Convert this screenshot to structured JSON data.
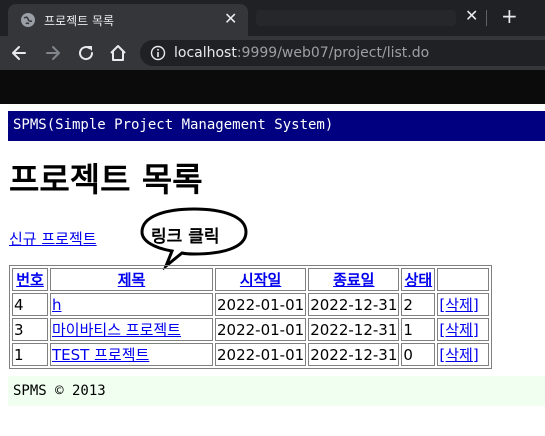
{
  "browser": {
    "tab_title": "프로젝트 목록",
    "tab_close_glyph": "✕",
    "tabbar_close_glyph": "✕",
    "new_tab_glyph": "+",
    "url_host": "localhost",
    "url_rest": ":9999/web07/project/list.do",
    "icons": [
      "globe-icon",
      "back-arrow-icon",
      "forward-arrow-icon",
      "reload-icon",
      "home-icon",
      "info-icon"
    ]
  },
  "page": {
    "header": "SPMS(Simple Project Management System)",
    "title": "프로젝트 목록",
    "new_project_link": "신규 프로젝트",
    "annotation": "링크 클릭",
    "table": {
      "headers": [
        "번호",
        "제목",
        "시작일",
        "종료일",
        "상태",
        ""
      ],
      "rows": [
        {
          "no": "4",
          "title": "h",
          "start": "2022-01-01",
          "end": "2022-12-31",
          "state": "2",
          "delete": "[삭제]"
        },
        {
          "no": "3",
          "title": "마이바티스 프로젝트",
          "start": "2022-01-01",
          "end": "2022-12-31",
          "state": "1",
          "delete": "[삭제]"
        },
        {
          "no": "1",
          "title": "TEST 프로젝트",
          "start": "2022-01-01",
          "end": "2022-12-31",
          "state": "0",
          "delete": "[삭제]"
        }
      ]
    },
    "footer": "SPMS © 2013"
  },
  "colors": {
    "header_bg": "#000080",
    "footer_bg": "#f0fff0",
    "link": "#0000ee",
    "chrome_dark": "#202124",
    "chrome_toolbar": "#35363a"
  }
}
